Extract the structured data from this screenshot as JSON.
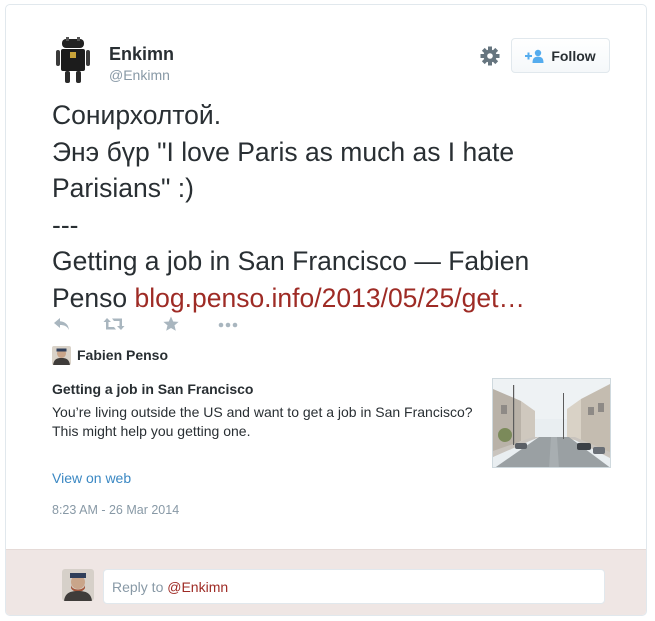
{
  "user": {
    "name": "Enkimn",
    "handle": "@Enkimn"
  },
  "follow_button": {
    "label": "Follow"
  },
  "tweet": {
    "text_line1": "Сонирхолтой.",
    "text_line2": "Энэ бүр \"I  love Paris as much as I hate",
    "text_line3": "Parisians\" :)",
    "text_line4": "---",
    "text_line5": "Getting a job in San Francisco — Fabien",
    "text_line6_prefix": "Penso ",
    "link": "blog.penso.info/2013/05/25/get…"
  },
  "actions": {
    "icons": [
      "reply-icon",
      "retweet-icon",
      "favorite-icon",
      "more-icon"
    ]
  },
  "card": {
    "author": "Fabien Penso",
    "title": "Getting a job in San Francisco",
    "description": "You’re living outside the US and want to get a job in San Francisco? This might help you getting one.",
    "view_on_web": "View on web"
  },
  "timestamp": "8:23 AM - 26 Mar 2014",
  "reply": {
    "prefix": "Reply to ",
    "mention": "@Enkimn"
  },
  "colors": {
    "link": "#9e2b25",
    "view_link": "#3b88c3",
    "reply_bar": "#efe6e4"
  }
}
